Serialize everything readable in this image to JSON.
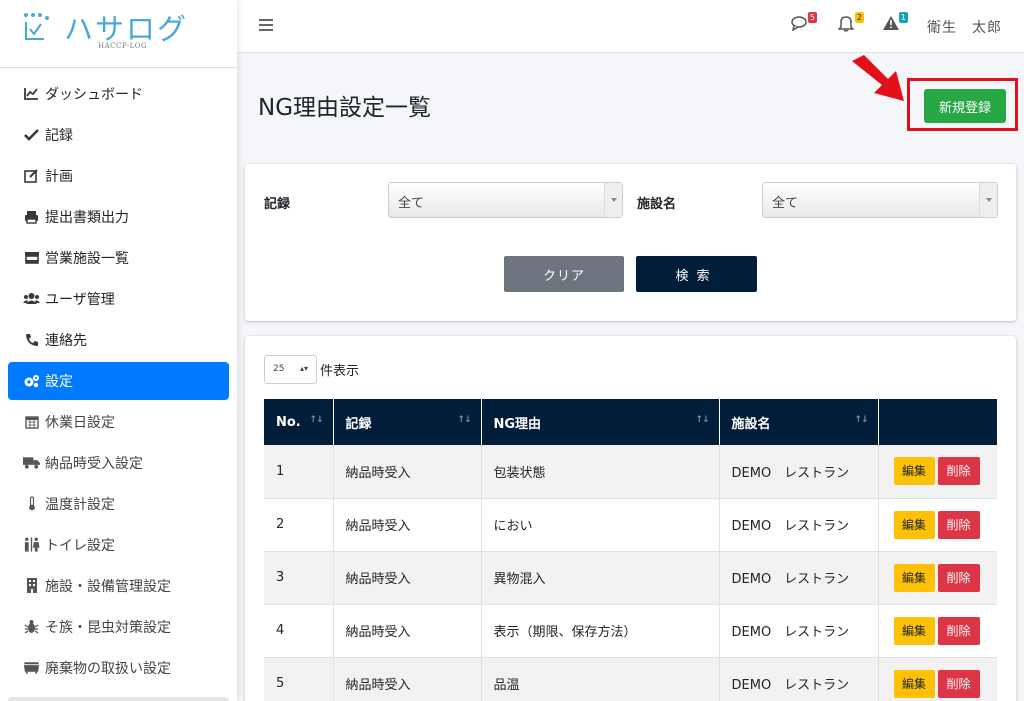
{
  "brand": {
    "name": "ハサログ",
    "sub": "HACCP-LOG"
  },
  "sidebar": {
    "items": [
      {
        "label": "ダッシュボード",
        "icon": "chart-line-icon"
      },
      {
        "label": "記録",
        "icon": "check-icon"
      },
      {
        "label": "計画",
        "icon": "edit-icon"
      },
      {
        "label": "提出書類出力",
        "icon": "print-icon"
      },
      {
        "label": "営業施設一覧",
        "icon": "store-icon"
      },
      {
        "label": "ユーザ管理",
        "icon": "users-icon"
      },
      {
        "label": "連絡先",
        "icon": "phone-icon"
      },
      {
        "label": "設定",
        "icon": "cogs-icon"
      }
    ],
    "sub_items": [
      {
        "label": "休業日設定",
        "icon": "calendar-icon"
      },
      {
        "label": "納品時受入設定",
        "icon": "truck-icon"
      },
      {
        "label": "温度計設定",
        "icon": "thermometer-icon"
      },
      {
        "label": "トイレ設定",
        "icon": "restroom-icon"
      },
      {
        "label": "施設・設備管理設定",
        "icon": "building-icon"
      },
      {
        "label": "そ族・昆虫対策設定",
        "icon": "bug-icon"
      },
      {
        "label": "廃棄物の取扱い設定",
        "icon": "dumpster-icon"
      }
    ]
  },
  "topbar": {
    "messages_count": "5",
    "notifications_count": "2",
    "alerts_count": "1",
    "user_name": "衛生　太郎",
    "colors": {
      "messages": "#dc3545",
      "notifications": "#ffc107",
      "alerts": "#17a2b8"
    }
  },
  "page": {
    "title": "NG理由設定一覧",
    "new_button": "新規登録"
  },
  "filter": {
    "record_label": "記録",
    "record_value": "全て",
    "facility_label": "施設名",
    "facility_value": "全て",
    "clear_label": "クリア",
    "search_label": "検索"
  },
  "list": {
    "page_length": "25",
    "page_length_suffix": "件表示",
    "columns": [
      "No.",
      "記録",
      "NG理由",
      "施設名",
      ""
    ],
    "edit_label": "編集",
    "delete_label": "削除",
    "rows": [
      {
        "no": "1",
        "record": "納品時受入",
        "reason": "包装状態",
        "facility": "DEMO　レストラン"
      },
      {
        "no": "2",
        "record": "納品時受入",
        "reason": "におい",
        "facility": "DEMO　レストラン"
      },
      {
        "no": "3",
        "record": "納品時受入",
        "reason": "異物混入",
        "facility": "DEMO　レストラン"
      },
      {
        "no": "4",
        "record": "納品時受入",
        "reason": "表示（期限、保存方法）",
        "facility": "DEMO　レストラン"
      },
      {
        "no": "5",
        "record": "納品時受入",
        "reason": "品温",
        "facility": "DEMO　レストラン"
      }
    ]
  }
}
